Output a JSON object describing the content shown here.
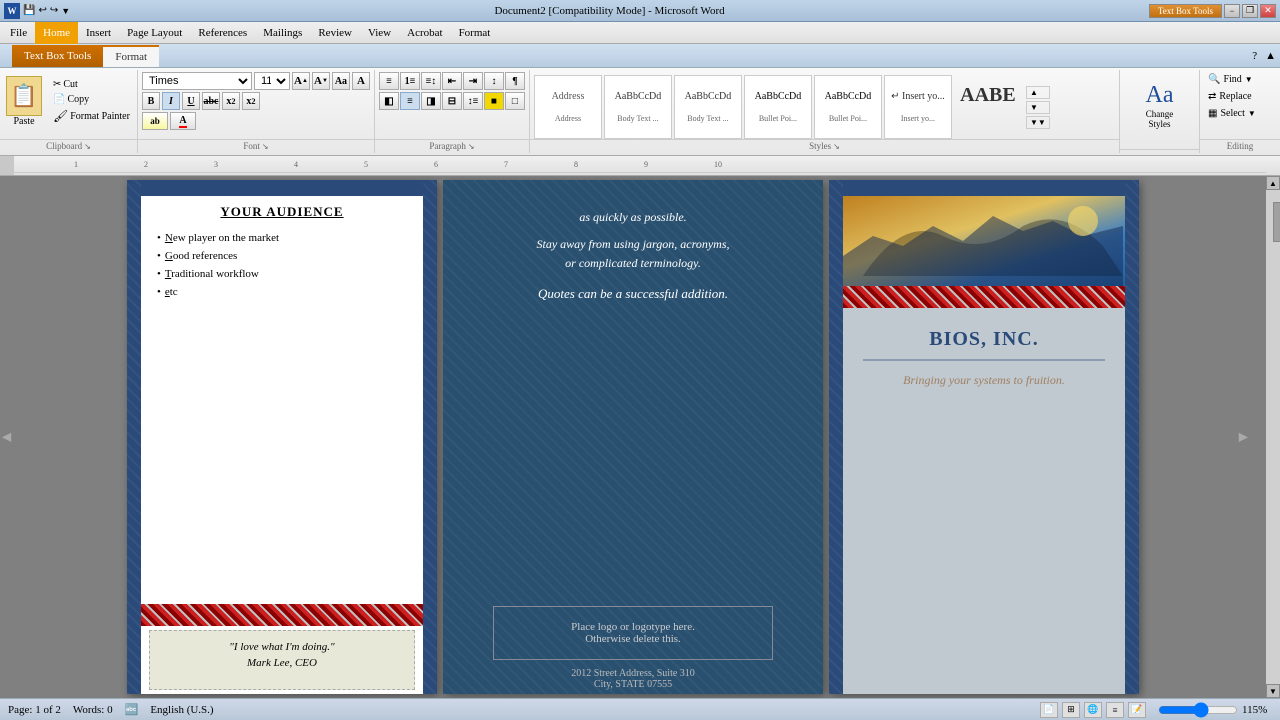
{
  "titleBar": {
    "title": "Document2 [Compatibility Mode] - Microsoft Word",
    "textBoxTools": "Text Box Tools",
    "minimize": "−",
    "maximize": "□",
    "close": "✕",
    "restore": "❐"
  },
  "menuBar": {
    "items": [
      {
        "label": "File",
        "active": false
      },
      {
        "label": "Home",
        "active": true
      },
      {
        "label": "Insert",
        "active": false
      },
      {
        "label": "Page Layout",
        "active": false
      },
      {
        "label": "References",
        "active": false
      },
      {
        "label": "Mailings",
        "active": false
      },
      {
        "label": "Review",
        "active": false
      },
      {
        "label": "View",
        "active": false
      },
      {
        "label": "Acrobat",
        "active": false
      },
      {
        "label": "Format",
        "active": false
      }
    ]
  },
  "ribbon": {
    "clipboard": {
      "label": "Clipboard",
      "paste": "Paste",
      "cut": "Cut",
      "copy": "Copy",
      "formatPainter": "Format Painter"
    },
    "font": {
      "label": "Font",
      "fontName": "Times",
      "fontSize": "11",
      "bold": "B",
      "italic": "I",
      "underline": "U",
      "strikethrough": "abc",
      "subscript": "x₂",
      "superscript": "x²",
      "grow": "A↑",
      "shrink": "A↓",
      "case": "Aa",
      "clearFormat": "A",
      "highlight": "ab",
      "fontColor": "A"
    },
    "paragraph": {
      "label": "Paragraph",
      "bullets": "≡",
      "numbering": "1≡",
      "multilevel": "≡↕",
      "decreaseIndent": "⇤",
      "increaseIndent": "⇥",
      "sort": "↕A",
      "showHide": "¶",
      "alignLeft": "≡",
      "alignCenter": "≡",
      "alignRight": "≡",
      "justify": "≡",
      "lineSpacing": "↕",
      "shading": "■",
      "borders": "□"
    },
    "styles": {
      "label": "Styles",
      "items": [
        {
          "name": "Address",
          "preview": "Address"
        },
        {
          "name": "Body Text ...",
          "preview": "Body Text"
        },
        {
          "name": "Body Text ...",
          "preview": "Body Text"
        },
        {
          "name": "Bullet Poi...",
          "preview": "• Bullet"
        },
        {
          "name": "Bullet Poi...",
          "preview": "• Bullet"
        },
        {
          "name": "Insert yo...",
          "preview": "Insert"
        },
        {
          "name": "AABE",
          "preview": "AABE"
        }
      ]
    },
    "changeStyles": {
      "label": "Change Styles",
      "icon": "Aa",
      "buttonLabel": "Change\nStyles"
    },
    "select": {
      "label": "Select",
      "buttonLabel": "Select"
    },
    "editing": {
      "label": "Editing",
      "find": "Find",
      "replace": "Replace",
      "select": "Select"
    }
  },
  "document": {
    "leftPage": {
      "title": "YOUR AUDIENCE",
      "bullets": [
        "New player on the market",
        "Good references",
        "Traditional workflow",
        "etc"
      ],
      "stripeBar": "",
      "quote": "\"I love what I'm doing.\"\nMark Lee, CEO"
    },
    "midPage": {
      "text1": "as quickly as possible.",
      "text2": "Stay away from using jargon, acronyms,\nor complicated terminology.",
      "quote": "Quotes can be a successful addition.",
      "logoBox": {
        "line1": "Place logo  or logotype here.",
        "line2": "Otherwise delete this."
      },
      "address": {
        "line1": "2012 Street Address,  Suite 310",
        "line2": "City, STATE 07555"
      }
    },
    "rightPage": {
      "companyName": "BIOS, INC.",
      "tagline": "Bringing your systems to fruition."
    }
  },
  "statusBar": {
    "page": "Page: 1 of 2",
    "words": "Words: 0",
    "language": "English (U.S.)",
    "zoom": "115%"
  }
}
